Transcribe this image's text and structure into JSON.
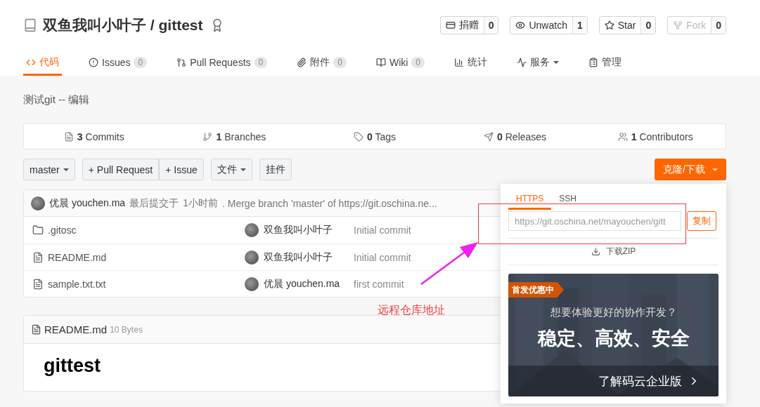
{
  "repo": {
    "owner": "双鱼我叫小叶子",
    "separator": "/",
    "name": "gittest"
  },
  "actions": [
    {
      "label": "捐赠",
      "count": "0",
      "disabled": false
    },
    {
      "label": "Unwatch",
      "count": "1",
      "disabled": false
    },
    {
      "label": "Star",
      "count": "0",
      "disabled": false
    },
    {
      "label": "Fork",
      "count": "0",
      "disabled": true
    }
  ],
  "nav": [
    {
      "label": "代码",
      "selected": true,
      "dropdown": false
    },
    {
      "label": "Issues",
      "count": "0",
      "selected": false,
      "dropdown": false
    },
    {
      "label": "Pull Requests",
      "count": "0",
      "selected": false,
      "dropdown": false
    },
    {
      "label": "附件",
      "count": "0",
      "selected": false,
      "dropdown": false
    },
    {
      "label": "Wiki",
      "count": "0",
      "selected": false,
      "dropdown": false
    },
    {
      "label": "统计",
      "selected": false,
      "dropdown": false
    },
    {
      "label": "服务",
      "selected": false,
      "dropdown": true
    },
    {
      "label": "管理",
      "selected": false,
      "dropdown": false
    }
  ],
  "description": "测试git -- 编辑",
  "stats": [
    {
      "count": "3",
      "label": "Commits"
    },
    {
      "count": "1",
      "label": "Branches"
    },
    {
      "count": "0",
      "label": "Tags"
    },
    {
      "count": "0",
      "label": "Releases"
    },
    {
      "count": "1",
      "label": "Contributors"
    }
  ],
  "toolbar": {
    "branch": "master",
    "new_buttons": [
      "+ Pull Request",
      "+ Issue"
    ],
    "file_menu": "文件",
    "plugins": "挂件",
    "clone_button": "克隆/下载"
  },
  "latest_commit": {
    "author": "优晨 youchen.ma",
    "label": "最后提交于",
    "time": "1小时前",
    "message": ". Merge branch 'master' of https://git.oschina.ne..."
  },
  "files": [
    {
      "name": ".gitosc",
      "kind": "folder",
      "author": "双鱼我叫小叶子",
      "message": "Initial commit"
    },
    {
      "name": "README.md",
      "kind": "file",
      "author": "双鱼我叫小叶子",
      "message": "Initial commit"
    },
    {
      "name": "sample.txt.txt",
      "kind": "file",
      "author": "优晨 youchen.ma",
      "message": "first commit"
    }
  ],
  "readme": {
    "title": "README.md",
    "size": "10 Bytes",
    "heading": "gittest"
  },
  "clone_panel": {
    "tabs": [
      {
        "label": "HTTPS",
        "selected": true
      },
      {
        "label": "SSH",
        "selected": false
      }
    ],
    "url": "https://git.oschina.net/mayouchen/gitt",
    "copy": "复制",
    "download": "下载ZIP",
    "promo": {
      "badge": "首发优惠中",
      "question": "想要体验更好的协作开发？",
      "slogan": "稳定、高效、安全",
      "link": "了解码云企业版"
    }
  },
  "annotation": {
    "text": "远程仓库地址"
  }
}
